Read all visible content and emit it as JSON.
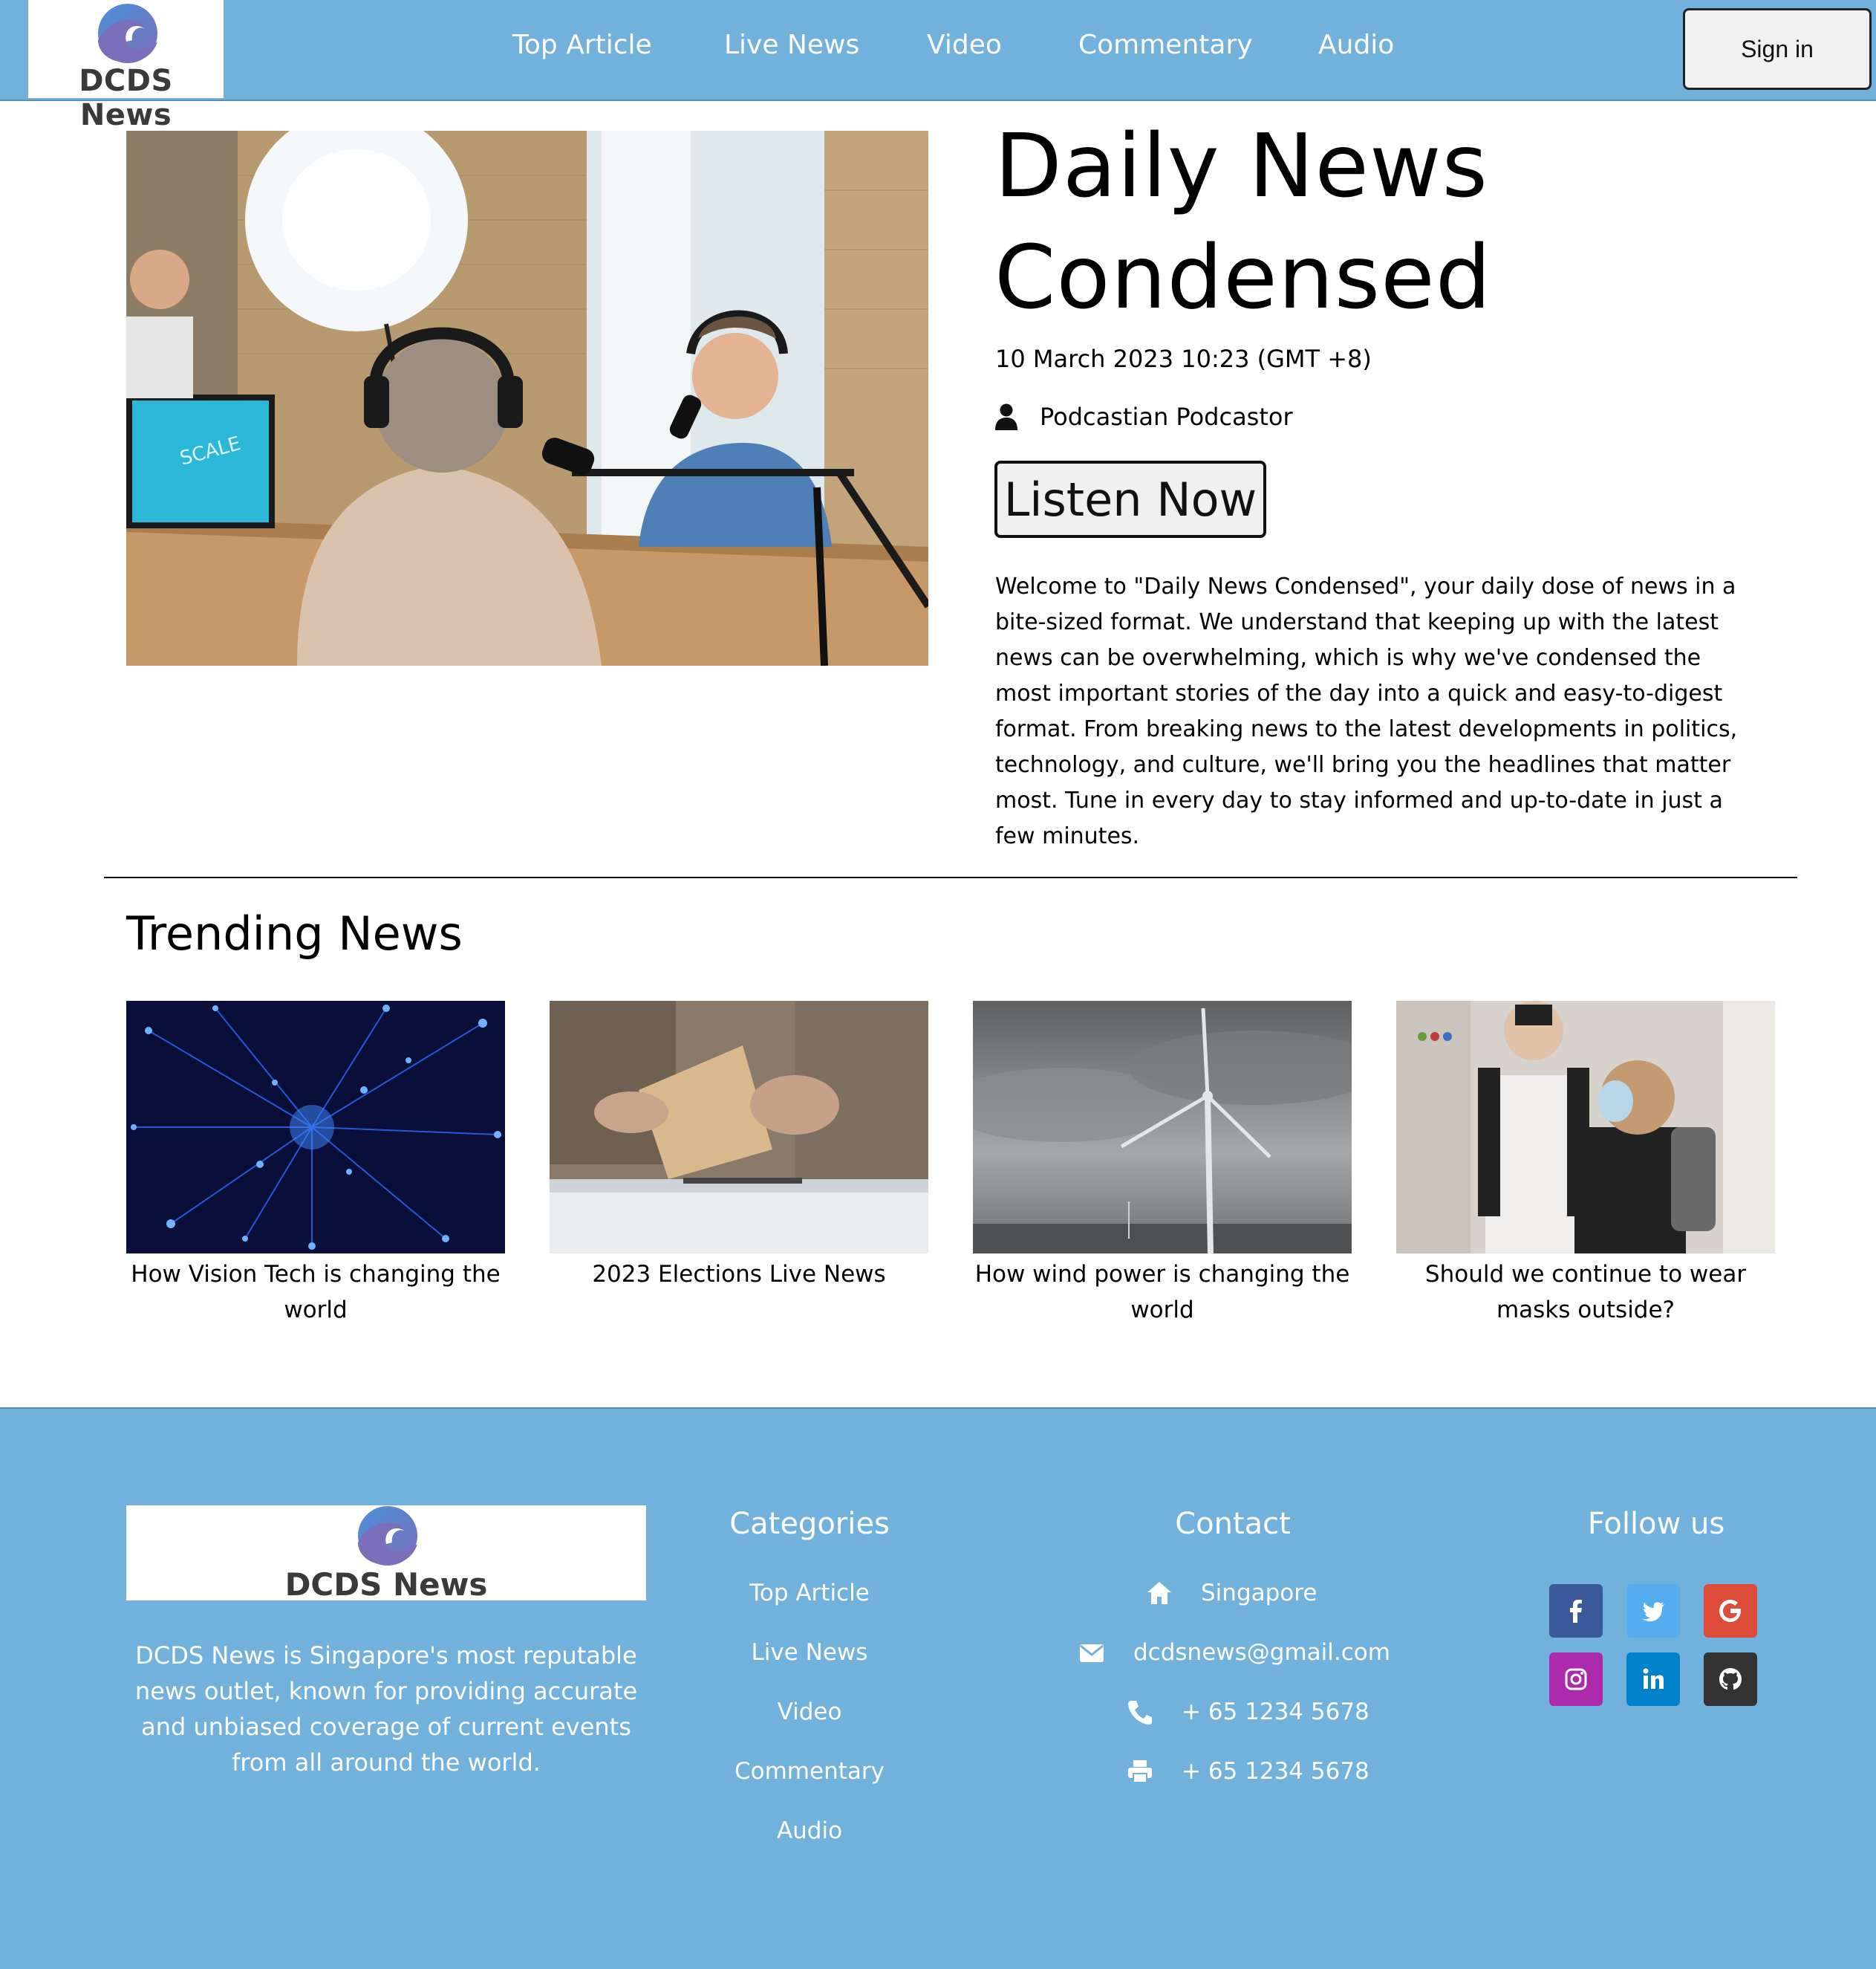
{
  "header": {
    "logo_text": "DCDS News",
    "nav": [
      "Top Article",
      "Live News",
      "Video",
      "Commentary",
      "Audio"
    ],
    "signin_label": "Sign in"
  },
  "hero": {
    "title": "Daily News Condensed",
    "date": "10 March 2023 10:23 (GMT +8)",
    "author": "Podcastian Podcastor",
    "listen_label": "Listen Now",
    "description": "Welcome to \"Daily News Condensed\", your daily dose of news in a bite-sized format. We understand that keeping up with the latest news can be overwhelming, which is why we've condensed the most important stories of the day into a quick and easy-to-digest format. From breaking news to the latest developments in politics, technology, and culture, we'll bring you the headlines that matter most. Tune in every day to stay informed and up-to-date in just a few minutes."
  },
  "trending": {
    "heading": "Trending News",
    "items": [
      {
        "caption": "How Vision Tech is changing the world"
      },
      {
        "caption": "2023 Elections Live News"
      },
      {
        "caption": "How wind power is changing the world"
      },
      {
        "caption": "Should we continue to wear masks outside?"
      }
    ]
  },
  "footer": {
    "logo_text": "DCDS News",
    "about": "DCDS News is Singapore's most reputable news outlet, known for providing accurate and unbiased coverage of current events from all around the world.",
    "categories_title": "Categories",
    "categories": [
      "Top Article",
      "Live News",
      "Video",
      "Commentary",
      "Audio"
    ],
    "contact_title": "Contact",
    "contact": {
      "location": "Singapore",
      "email": "dcdsnews@gmail.com",
      "phone": "+ 65 1234 5678",
      "fax": "+ 65 1234 5678"
    },
    "follow_title": "Follow us",
    "social": [
      {
        "icon": "facebook-icon",
        "color": "#3b5998"
      },
      {
        "icon": "twitter-icon",
        "color": "#55acee"
      },
      {
        "icon": "google-icon",
        "color": "#dd4b39"
      },
      {
        "icon": "instagram-icon",
        "color": "#ac2bac"
      },
      {
        "icon": "linkedin-icon",
        "color": "#0082ca"
      },
      {
        "icon": "github-icon",
        "color": "#333333"
      }
    ]
  },
  "colors": {
    "brand_blue": "#72b1dc",
    "logo_wave_blue": "#4a90d9",
    "logo_wave_purple": "#7a6fb8"
  }
}
